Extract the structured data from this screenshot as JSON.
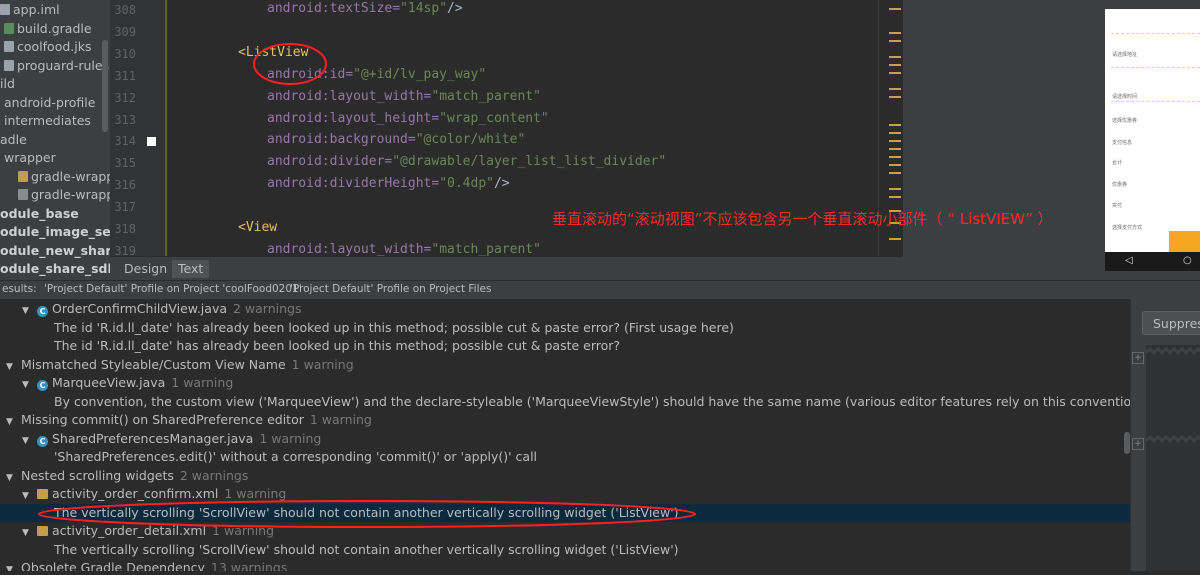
{
  "project_tree": {
    "items": [
      {
        "label": "app.iml",
        "icon": "file-icon",
        "color": "#9aa3ad"
      },
      {
        "label": "build.gradle",
        "icon": "gradle-file-icon",
        "color": "#5b8c5b"
      },
      {
        "label": "coolfood.jks",
        "icon": "keystore-file-icon",
        "color": "#9aa3ad"
      },
      {
        "label": "proguard-rules.pro",
        "icon": "file-icon",
        "color": "#9aa3ad"
      },
      {
        "label": "ild",
        "icon": "",
        "color": ""
      },
      {
        "label": "android-profile",
        "icon": "",
        "color": ""
      },
      {
        "label": "intermediates",
        "icon": "",
        "color": ""
      },
      {
        "label": "adle",
        "icon": "",
        "color": ""
      },
      {
        "label": "wrapper",
        "icon": "",
        "color": ""
      },
      {
        "label": "gradle-wrapper.j",
        "icon": "jar-file-icon",
        "color": "#c29d4b"
      },
      {
        "label": "gradle-wrapper.p",
        "icon": "properties-file-icon",
        "color": "#8a8a8a"
      },
      {
        "label": "odule_base",
        "icon": "",
        "color": ""
      },
      {
        "label": "odule_image_selecto",
        "icon": "",
        "color": ""
      },
      {
        "label": "odule_new_share_sd",
        "icon": "",
        "color": ""
      },
      {
        "label": "odule_share_sdk",
        "icon": "",
        "color": ""
      }
    ]
  },
  "editor": {
    "line_numbers": [
      "308",
      "309",
      "310",
      "311",
      "312",
      "313",
      "314",
      "315",
      "316",
      "317",
      "318",
      "319"
    ],
    "lines": [
      {
        "indent": "        ",
        "tokens": [
          {
            "t": "attr",
            "v": "android:textSize="
          },
          {
            "t": "val",
            "v": "\"14sp\""
          },
          {
            "t": "pun",
            "v": "/>"
          }
        ]
      },
      {
        "indent": "",
        "tokens": []
      },
      {
        "indent": "    ",
        "tokens": [
          {
            "t": "tag",
            "v": "<ListView"
          }
        ]
      },
      {
        "indent": "        ",
        "tokens": [
          {
            "t": "attr",
            "v": "android:id="
          },
          {
            "t": "val",
            "v": "\"@+id/lv_pay_way\""
          }
        ]
      },
      {
        "indent": "        ",
        "tokens": [
          {
            "t": "attr",
            "v": "android:layout_width="
          },
          {
            "t": "val",
            "v": "\"match_parent\""
          }
        ]
      },
      {
        "indent": "        ",
        "tokens": [
          {
            "t": "attr",
            "v": "android:layout_height="
          },
          {
            "t": "val",
            "v": "\"wrap_content\""
          }
        ]
      },
      {
        "indent": "        ",
        "tokens": [
          {
            "t": "attr",
            "v": "android:background="
          },
          {
            "t": "val",
            "v": "\"@color/white\""
          }
        ]
      },
      {
        "indent": "        ",
        "tokens": [
          {
            "t": "attr",
            "v": "android:divider="
          },
          {
            "t": "val",
            "v": "\"@drawable/layer_list_list_divider\""
          }
        ]
      },
      {
        "indent": "        ",
        "tokens": [
          {
            "t": "attr",
            "v": "android:dividerHeight="
          },
          {
            "t": "val",
            "v": "\"0.4dp\""
          },
          {
            "t": "pun",
            "v": "/>"
          }
        ]
      },
      {
        "indent": "",
        "tokens": []
      },
      {
        "indent": "    ",
        "tokens": [
          {
            "t": "tag",
            "v": "<View"
          }
        ]
      },
      {
        "indent": "        ",
        "tokens": [
          {
            "t": "attr",
            "v": "android:layout_width="
          },
          {
            "t": "val",
            "v": "\"match_parent\""
          }
        ]
      }
    ]
  },
  "annotation": {
    "text": "垂直滚动的“滚动视图”不应该包含另一个垂直滚动小部件（ “ ListVIEW” ）",
    "color": "#ff2a2a"
  },
  "preview": {
    "labels": [
      "请选择地址",
      "请选择时间",
      "选择优惠券",
      "支付信息",
      "合计",
      "优惠券",
      "实付",
      "选择支付方式"
    ],
    "accent": "#f5a623"
  },
  "tabs": [
    {
      "label": "Design",
      "active": false
    },
    {
      "label": "Text",
      "active": true
    }
  ],
  "results_header": {
    "label": "esults:",
    "profile_project": "'Project Default' Profile on Project 'coolFood0201'",
    "profile_files": "'Project Default' Profile on Project Files"
  },
  "detail": {
    "suppress_label": "Suppress"
  },
  "inspection_rows": [
    {
      "level": 1,
      "arrow": "▼",
      "icon": "class",
      "text": "OrderConfirmChildView.java",
      "count": "2 warnings"
    },
    {
      "level": 2,
      "arrow": "",
      "icon": "",
      "text": "The id 'R.id.ll_date' has already been looked up in this method; possible cut & paste error? (First usage here)",
      "count": ""
    },
    {
      "level": 2,
      "arrow": "",
      "icon": "",
      "text": "The id 'R.id.ll_date' has already been looked up in this method; possible cut & paste error?",
      "count": ""
    },
    {
      "level": 0,
      "arrow": "▼",
      "icon": "",
      "text": "Mismatched Styleable/Custom View Name",
      "count": "1 warning"
    },
    {
      "level": 1,
      "arrow": "▼",
      "icon": "class",
      "text": "MarqueeView.java",
      "count": "1 warning"
    },
    {
      "level": 2,
      "arrow": "",
      "icon": "",
      "text": "By convention, the custom view ('MarqueeView') and the declare-styleable ('MarqueeViewStyle') should have the same name (various editor features rely on this convention)",
      "count": ""
    },
    {
      "level": 0,
      "arrow": "▼",
      "icon": "",
      "text": "Missing commit() on SharedPreference editor",
      "count": "1 warning"
    },
    {
      "level": 1,
      "arrow": "▼",
      "icon": "class",
      "text": "SharedPreferencesManager.java",
      "count": "1 warning"
    },
    {
      "level": 2,
      "arrow": "",
      "icon": "",
      "text": "'SharedPreferences.edit()' without a corresponding 'commit()' or 'apply()' call",
      "count": ""
    },
    {
      "level": 0,
      "arrow": "▼",
      "icon": "",
      "text": "Nested scrolling widgets",
      "count": "2 warnings"
    },
    {
      "level": 1,
      "arrow": "▼",
      "icon": "xml",
      "text": "activity_order_confirm.xml",
      "count": "1 warning"
    },
    {
      "level": 2,
      "arrow": "",
      "icon": "",
      "text": "The vertically scrolling 'ScrollView' should not contain another vertically scrolling widget ('ListView')",
      "count": "",
      "selected": true
    },
    {
      "level": 1,
      "arrow": "▼",
      "icon": "xml",
      "text": "activity_order_detail.xml",
      "count": "1 warning"
    },
    {
      "level": 2,
      "arrow": "",
      "icon": "",
      "text": "The vertically scrolling 'ScrollView' should not contain another vertically scrolling widget ('ListView')",
      "count": ""
    },
    {
      "level": 0,
      "arrow": "▼",
      "icon": "",
      "text": "Obsolete Gradle Dependency",
      "count": "13 warnings"
    }
  ]
}
